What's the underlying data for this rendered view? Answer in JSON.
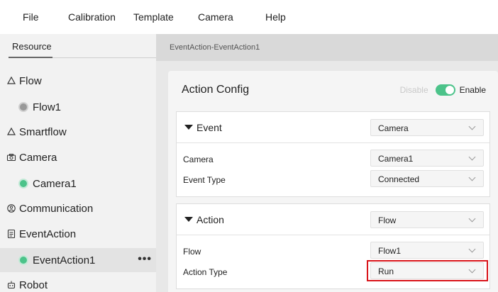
{
  "menu": {
    "file": "File",
    "calibration": "Calibration",
    "template": "Template",
    "camera": "Camera",
    "help": "Help"
  },
  "sidebar": {
    "tab_label": "Resource",
    "items": [
      {
        "label": "Flow",
        "icon": "triangle-icon"
      },
      {
        "label": "Flow1",
        "status_color": "#999999"
      },
      {
        "label": "Smartflow",
        "icon": "triangle-icon"
      },
      {
        "label": "Camera",
        "icon": "camera-icon"
      },
      {
        "label": "Camera1",
        "status_color": "#4cc38a"
      },
      {
        "label": "Communication",
        "icon": "communication-icon"
      },
      {
        "label": "EventAction",
        "icon": "document-icon"
      },
      {
        "label": "EventAction1",
        "status_color": "#4cc38a",
        "more": "•••"
      },
      {
        "label": "Robot",
        "icon": "robot-icon"
      }
    ]
  },
  "main": {
    "breadcrumb": "EventAction-EventAction1",
    "card_title": "Action Config",
    "toggle": {
      "off_label": "Disable",
      "on_label": "Enable",
      "on": true,
      "accent": "#4cc38a"
    },
    "event": {
      "title": "Event",
      "type_value": "Camera",
      "fields": [
        {
          "label": "Camera",
          "value": "Camera1"
        },
        {
          "label": "Event Type",
          "value": "Connected"
        }
      ]
    },
    "action": {
      "title": "Action",
      "type_value": "Flow",
      "fields": [
        {
          "label": "Flow",
          "value": "Flow1"
        },
        {
          "label": "Action Type",
          "value": "Run"
        }
      ]
    }
  },
  "highlight_color": "#d9141a"
}
